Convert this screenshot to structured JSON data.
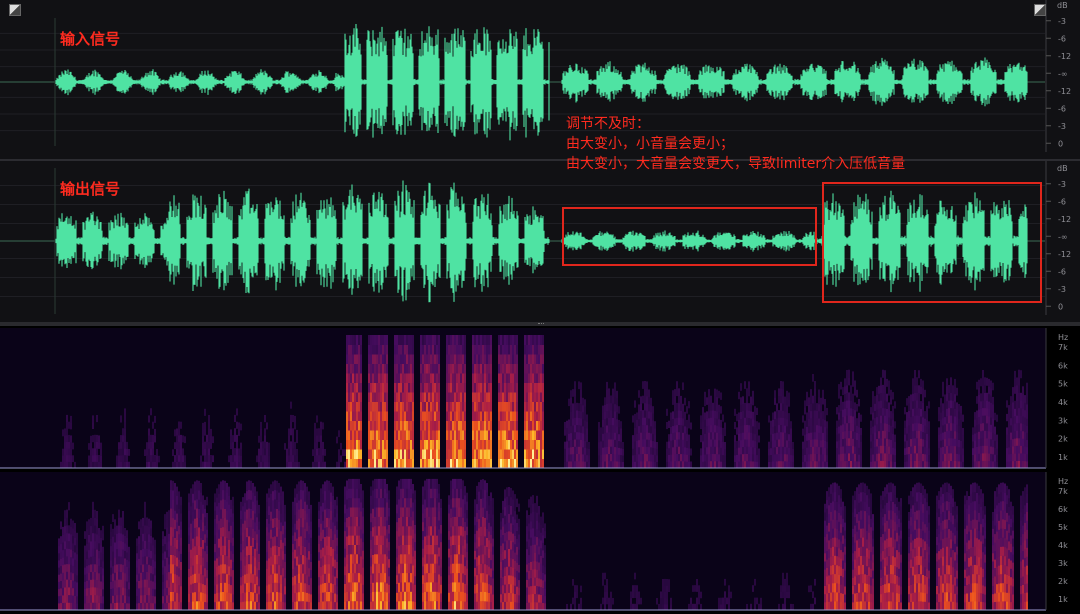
{
  "waveform": {
    "input_label": "输入信号",
    "output_label": "输出信号",
    "unit": "dB",
    "input_scale": [
      "-3",
      "-6",
      "-12",
      "-∞",
      "-12",
      "-6",
      "-3",
      "0"
    ],
    "output_scale": [
      "-3",
      "-6",
      "-12",
      "-∞",
      "-12",
      "-6",
      "-3",
      "0"
    ],
    "annotation_lines": [
      "调节不及时：",
      "由大变小，小音量会更小；",
      "由大变小，大音量会变更大，导致limiter介入压低音量"
    ],
    "color": "#4fe3a3",
    "highlight_color": "#e0261c"
  },
  "spectrogram": {
    "unit": "Hz",
    "top_scale": [
      "7k",
      "6k",
      "5k",
      "4k",
      "3k",
      "2k",
      "1k"
    ],
    "bottom_scale": [
      "7k",
      "6k",
      "5k",
      "4k",
      "3k",
      "2k",
      "1k"
    ]
  }
}
